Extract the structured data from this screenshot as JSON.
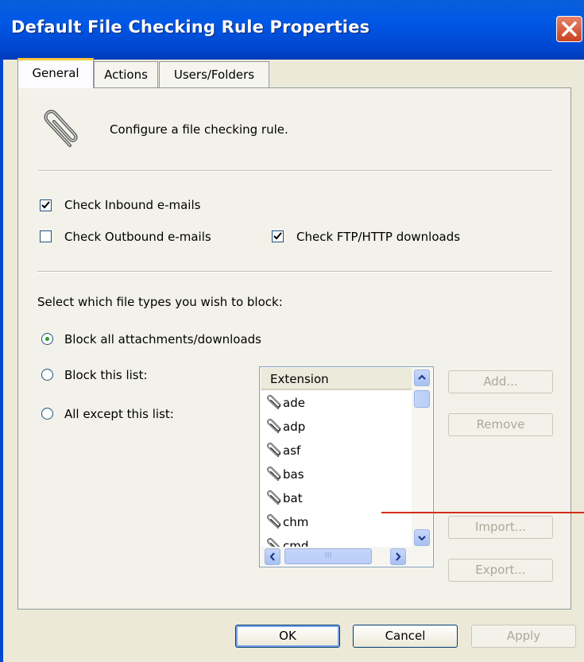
{
  "window": {
    "title": "Default File Checking Rule Properties"
  },
  "tabs": [
    {
      "label": "General",
      "active": true
    },
    {
      "label": "Actions",
      "active": false
    },
    {
      "label": "Users/Folders",
      "active": false
    }
  ],
  "general": {
    "description": "Configure a file checking rule.",
    "description_icon": "paperclip-icon",
    "check_inbound": {
      "label": "Check Inbound e-mails",
      "checked": true
    },
    "check_outbound": {
      "label": "Check Outbound e-mails",
      "checked": false
    },
    "check_ftp_http": {
      "label": "Check FTP/HTTP downloads",
      "checked": true
    },
    "file_types_prompt": "Select which file types you wish to block:",
    "radios": [
      {
        "label": "Block all attachments/downloads",
        "selected": true
      },
      {
        "label": "Block this list:",
        "selected": false
      },
      {
        "label": "All except this list:",
        "selected": false
      }
    ],
    "extension_list": {
      "header": "Extension",
      "items": [
        "ade",
        "adp",
        "asf",
        "bas",
        "bat",
        "chm",
        "cmd"
      ],
      "item_icon": "paperclip-icon",
      "horizontal_scroll_grip": "III"
    },
    "list_buttons": {
      "add": "Add...",
      "remove": "Remove",
      "import": "Import...",
      "export": "Export..."
    }
  },
  "footer": {
    "ok": "OK",
    "cancel": "Cancel",
    "apply": "Apply"
  },
  "colors": {
    "titlebar": "#0058e6",
    "dialog_bg": "#ece9d8",
    "active_tab_accent": "#ffc83c",
    "annotation_line": "#d12e1a"
  }
}
